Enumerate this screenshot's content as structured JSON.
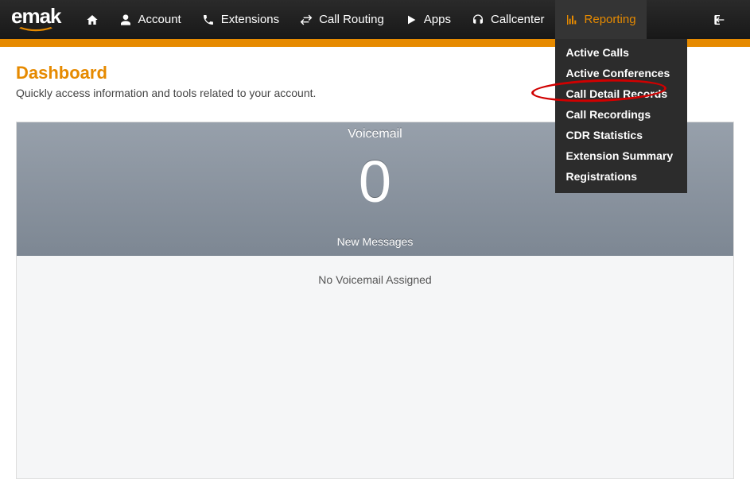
{
  "brand": "emak",
  "nav": {
    "home_title": "Home",
    "account": "Account",
    "extensions": "Extensions",
    "call_routing": "Call Routing",
    "apps": "Apps",
    "callcenter": "Callcenter",
    "reporting": "Reporting"
  },
  "dropdown": {
    "0": "Active Calls",
    "1": "Active Conferences",
    "2": "Call Detail Records",
    "3": "Call Recordings",
    "4": "CDR Statistics",
    "5": "Extension Summary",
    "6": "Registrations"
  },
  "page": {
    "title": "Dashboard",
    "subtitle": "Quickly access information and tools related to your account."
  },
  "voicemail": {
    "title": "Voicemail",
    "count": "0",
    "caption": "New Messages",
    "empty": "No Voicemail Assigned"
  }
}
